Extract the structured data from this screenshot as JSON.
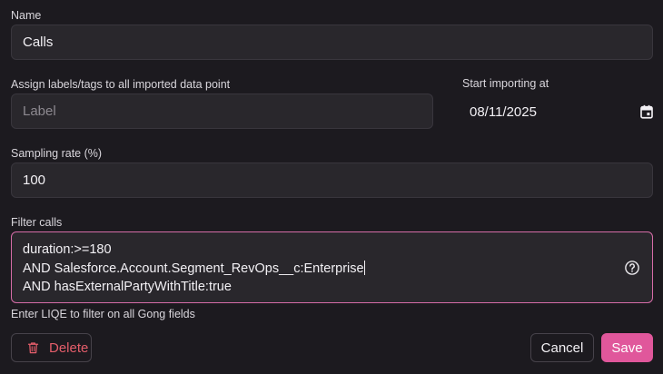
{
  "name": {
    "label": "Name",
    "value": "Calls"
  },
  "labels": {
    "label": "Assign labels/tags to all imported data point",
    "placeholder": "Label"
  },
  "start": {
    "label": "Start importing at",
    "value": "08/11/2025",
    "icon": "calendar-icon"
  },
  "sampling": {
    "label": "Sampling rate (%)",
    "value": "100"
  },
  "filter": {
    "label": "Filter calls",
    "lines": [
      "duration:>=180",
      "AND Salesforce.Account.Segment_RevOps__c:Enterprise",
      "AND hasExternalPartyWithTitle:true"
    ],
    "help_icon": "help-circle-icon",
    "hint": "Enter LIQE to filter on all Gong fields"
  },
  "actions": {
    "delete_label": "Delete",
    "delete_icon": "trash-icon",
    "cancel_label": "Cancel",
    "save_label": "Save"
  },
  "colors": {
    "background": "#1c1a1f",
    "field": "#29272c",
    "accent": "#e0579b",
    "danger": "#e35d6a"
  }
}
